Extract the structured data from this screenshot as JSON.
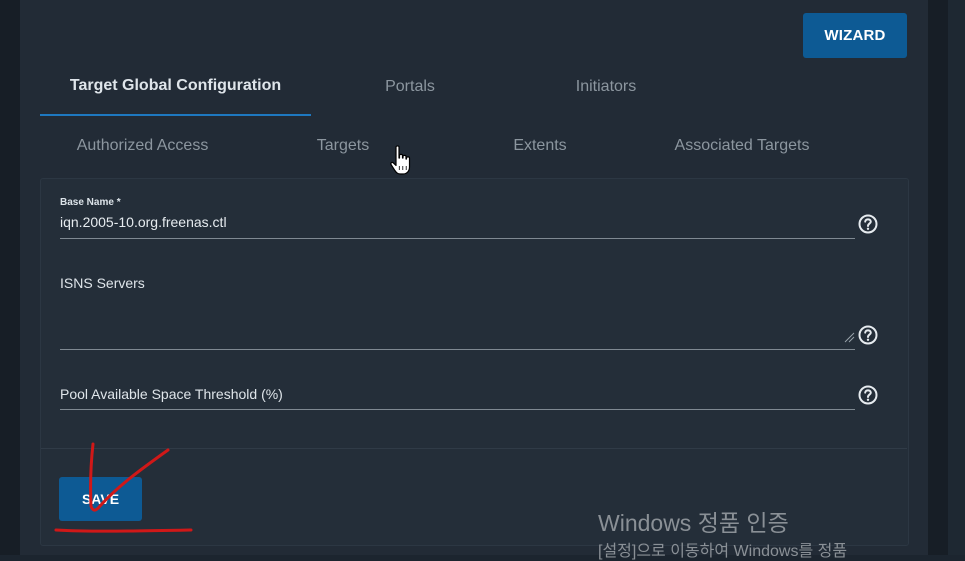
{
  "header": {
    "wizard_label": "WIZARD"
  },
  "tabs_row1": [
    {
      "label": "Target Global Configuration",
      "active": true
    },
    {
      "label": "Portals",
      "active": false
    },
    {
      "label": "Initiators",
      "active": false
    }
  ],
  "tabs_row2": [
    {
      "label": "Authorized Access",
      "active": false
    },
    {
      "label": "Targets",
      "active": false
    },
    {
      "label": "Extents",
      "active": false
    },
    {
      "label": "Associated Targets",
      "active": false
    }
  ],
  "form": {
    "base_name": {
      "label": "Base Name *",
      "value": "iqn.2005-10.org.freenas.ctl"
    },
    "isns_servers": {
      "label": "ISNS Servers",
      "value": ""
    },
    "pool_threshold": {
      "label": "Pool Available Space Threshold (%)",
      "value": ""
    },
    "help_icon": "help-circle-icon",
    "save_label": "SAVE"
  },
  "watermark": {
    "title": "Windows 정품 인증",
    "subtitle": "[설정]으로 이동하여 Windows를 정품"
  },
  "colors": {
    "page_bg": "#1c252f",
    "card_bg": "#222b36",
    "accent": "#0d5a94",
    "tab_underline": "#1e78c0",
    "annotation": "#d01818"
  }
}
